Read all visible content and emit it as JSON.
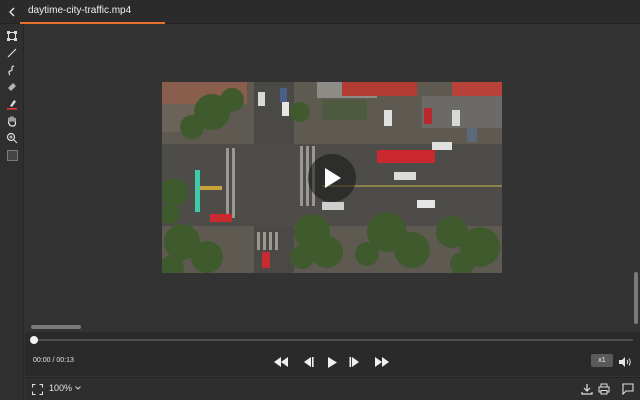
{
  "titlebar": {
    "file_name": "daytime-city-traffic.mp4"
  },
  "toolbar": {
    "tools": [
      "crop-tool",
      "line-tool",
      "freehand-tool",
      "eraser-tool",
      "highlighter-tool",
      "pan-tool",
      "zoom-tool",
      "color-swatch"
    ],
    "accent_color": "#e8702a"
  },
  "player": {
    "time": "00:00 / 00:13",
    "speed": "x1",
    "progress": 0
  },
  "statusbar": {
    "zoom": "100%"
  },
  "colors": {
    "background": "#333333",
    "accent": "#e8702a"
  }
}
